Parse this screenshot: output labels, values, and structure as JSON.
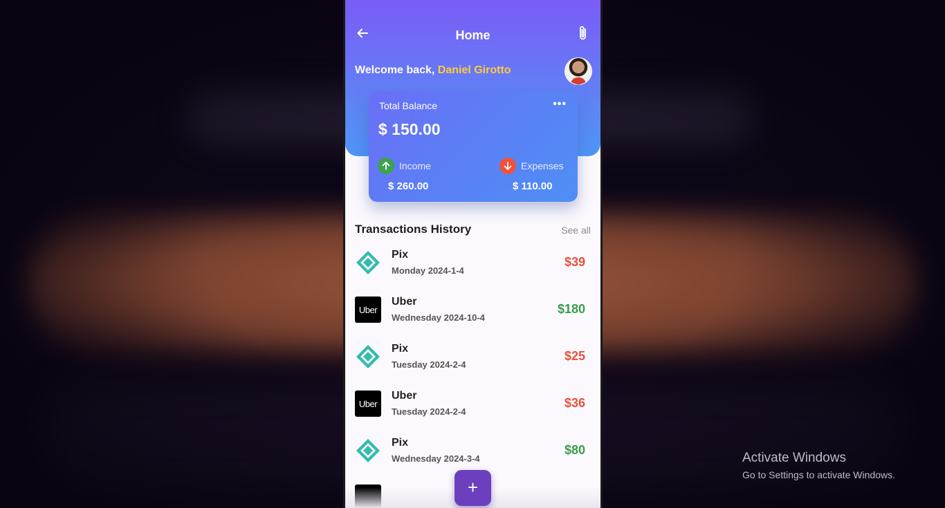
{
  "header": {
    "title": "Home",
    "welcome_prefix": "Welcome back, ",
    "user_name": "Daniel Girotto"
  },
  "balance_card": {
    "label": "Total Balance",
    "more": "•••",
    "total": "$ 150.00",
    "income_label": "Income",
    "income_value": "$ 260.00",
    "expenses_label": "Expenses",
    "expenses_value": "$ 110.00"
  },
  "transactions": {
    "title": "Transactions History",
    "see_all": "See all",
    "items": [
      {
        "name": "Pix",
        "date": "Monday  2024-1-4",
        "amount": "$39",
        "logo": "pix-logo",
        "color": "#e8523a"
      },
      {
        "name": "Uber",
        "date": "Wednesday  2024-10-4",
        "amount": "$180",
        "logo": "uber-logo",
        "logo_text": "Uber",
        "color": "#3a9d4c"
      },
      {
        "name": "Pix",
        "date": "Tuesday  2024-2-4",
        "amount": "$25",
        "logo": "pix-logo",
        "color": "#e8523a"
      },
      {
        "name": "Uber",
        "date": "Tuesday  2024-2-4",
        "amount": "$36",
        "logo": "uber-logo",
        "logo_text": "Uber",
        "color": "#e8523a"
      },
      {
        "name": "Pix",
        "date": "Wednesday  2024-3-4",
        "amount": "$80",
        "logo": "pix-logo",
        "color": "#3a9d4c"
      }
    ]
  },
  "fab": {
    "label": "+"
  },
  "windows_watermark": {
    "line1": "Activate Windows",
    "line2": "Go to Settings to activate Windows."
  },
  "colors": {
    "header_gradient_start": "#7a5cf6",
    "header_gradient_end": "#4f95f5",
    "welcome_name": "#ffcc3a",
    "income_icon": "#3fa14e",
    "expenses_icon": "#f0513b",
    "fab": "#6b3fbd",
    "pix_logo": "#32bcad"
  }
}
